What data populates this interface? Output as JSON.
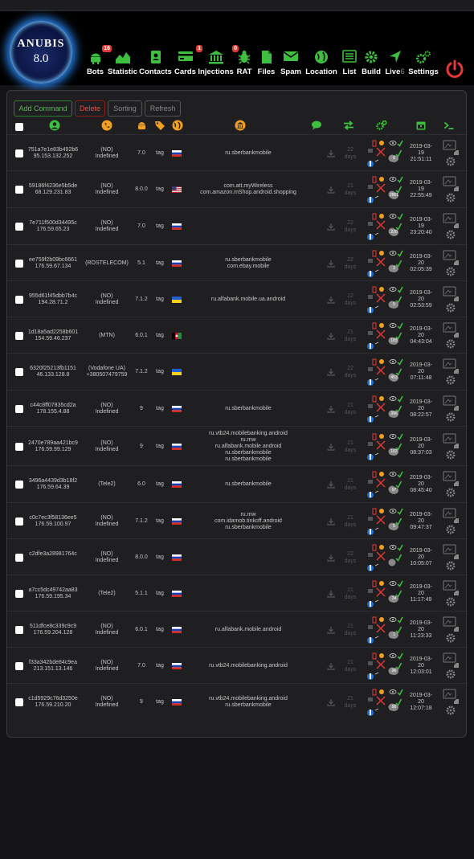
{
  "logo": {
    "title": "ANUBIS",
    "version": "8.0"
  },
  "nav": [
    {
      "label": "Bots",
      "icon": "android-icon",
      "badge": "16"
    },
    {
      "label": "Statistic",
      "icon": "chart-area-icon",
      "badge": ""
    },
    {
      "label": "Contacts",
      "icon": "contacts-book-icon",
      "badge": ""
    },
    {
      "label": "Cards",
      "icon": "credit-card-icon",
      "badge": "1"
    },
    {
      "label": "Injections",
      "icon": "bank-icon",
      "badge": "0"
    },
    {
      "label": "RAT",
      "icon": "bug-icon",
      "badge": ""
    },
    {
      "label": "Files",
      "icon": "files-icon",
      "badge": ""
    },
    {
      "label": "Spam",
      "icon": "envelope-icon",
      "badge": ""
    },
    {
      "label": "Location",
      "icon": "globe-icon",
      "badge": ""
    },
    {
      "label": "List",
      "icon": "list-icon",
      "badge": ""
    },
    {
      "label": "Build",
      "icon": "gear-icon",
      "badge": ""
    },
    {
      "label": "Live",
      "icon": "location-arrow-icon",
      "badge": "",
      "count": "6"
    },
    {
      "label": "Settings",
      "icon": "cogs-icon",
      "badge": ""
    }
  ],
  "toolbar": {
    "add": "Add Command",
    "delete": "Delete",
    "sorting": "Sorting",
    "refresh": "Refresh"
  },
  "columns": [
    "select",
    "user-id",
    "operator",
    "android-version",
    "tag",
    "country",
    "injections",
    "sms",
    "status",
    "permissions",
    "date",
    "console"
  ],
  "colors": {
    "accent_green": "#3fbf3f",
    "danger_red": "#e53935",
    "bg": "#1f1f22"
  },
  "rows": [
    {
      "id": "751a7e1e83b492b6",
      "ip": "95.153.132.252",
      "op1": "(NO)",
      "op2": "Indefined",
      "ver": "7.0",
      "tag": "tag",
      "flag": "ru",
      "apps": [
        "ru.sberbankmobile"
      ],
      "days1": "22",
      "days2": "days",
      "perm": "6",
      "date": [
        "2019-03-",
        "19",
        "21:51:11"
      ]
    },
    {
      "id": "59186f4236e5b5de",
      "ip": "68.129.231.83",
      "op1": "(NO)",
      "op2": "Indefined",
      "ver": "8.0.0",
      "tag": "tag",
      "flag": "us",
      "apps": [
        "com.att.myWireless",
        "com.amazon.mShop.android.shopping"
      ],
      "days1": "21",
      "days2": "days",
      "perm": "2861",
      "date": [
        "2019-03-",
        "19",
        "22:55:49"
      ]
    },
    {
      "id": "7e711f500d34495c",
      "ip": "176.59.65.23",
      "op1": "(NO)",
      "op2": "Indefined",
      "ver": "7.0",
      "tag": "tag",
      "flag": "ru",
      "apps": [],
      "days1": "22",
      "days2": "days",
      "perm": "220",
      "date": [
        "2019-03-",
        "19",
        "23:20:40"
      ]
    },
    {
      "id": "ee759f2b09bc6661",
      "ip": "176.59.67.134",
      "op1": "(ROSTELECOM)",
      "op2": "",
      "ver": "5.1",
      "tag": "tag",
      "flag": "ru",
      "apps": [
        "ru.sberbankmobile",
        "com.ebay.mobile"
      ],
      "days1": "22",
      "days2": "days",
      "perm": "3",
      "date": [
        "2019-03-",
        "20",
        "02:05:39"
      ]
    },
    {
      "id": "955d61f45dbb7b4c",
      "ip": "194.28.71.2",
      "op1": "(NO)",
      "op2": "Indefined",
      "ver": "7.1.2",
      "tag": "tag",
      "flag": "ua",
      "apps": [
        "ru.alfabank.mobile.ua.android"
      ],
      "days1": "22",
      "days2": "days",
      "perm": "5",
      "date": [
        "2019-03-",
        "20",
        "02:53:59"
      ]
    },
    {
      "id": "1d18a5ad2258b601",
      "ip": "154.59.46.237",
      "op1": "(MTN)",
      "op2": "",
      "ver": "6.0.1",
      "tag": "tag",
      "flag": "af",
      "apps": [],
      "days1": "21",
      "days2": "days",
      "perm": "183",
      "date": [
        "2019-03-",
        "20",
        "04:43:04"
      ]
    },
    {
      "id": "6320f25213fb1151",
      "ip": "46.133.128.8",
      "op1": "(Vodafone UA)",
      "op2": "+380507479759",
      "ver": "7.1.2",
      "tag": "tag",
      "flag": "ua",
      "apps": [],
      "days1": "22",
      "days2": "days",
      "perm": "453",
      "date": [
        "2019-03-",
        "20",
        "07:11:48"
      ]
    },
    {
      "id": "c44c8ff07835cd2a",
      "ip": "178.155.4.88",
      "op1": "(NO)",
      "op2": "Indefined",
      "ver": "9",
      "tag": "tag",
      "flag": "ru",
      "apps": [
        "ru.sberbankmobile"
      ],
      "days1": "21",
      "days2": "days",
      "perm": "396",
      "date": [
        "2019-03-",
        "20",
        "08:22:57"
      ]
    },
    {
      "id": "2470e789aa421bc9",
      "ip": "176.59.99.129",
      "op1": "(NO)",
      "op2": "Indefined",
      "ver": "9",
      "tag": "tag",
      "flag": "ru",
      "apps": [
        "ru.vtb24.mobilebanking.android",
        "ru.mw",
        "ru.alfabank.mobile.android",
        "ru.sberbankmobile",
        "ru.sberbankmobile"
      ],
      "days1": "21",
      "days2": "days",
      "perm": "102",
      "date": [
        "2019-03-",
        "20",
        "08:37:03"
      ]
    },
    {
      "id": "3496a4439d3b18f2",
      "ip": "176.59.64.39",
      "op1": "(Tele2)",
      "op2": "",
      "ver": "6.0",
      "tag": "tag",
      "flag": "ru",
      "apps": [
        "ru.sberbankmobile"
      ],
      "days1": "21",
      "days2": "days",
      "perm": "97",
      "date": [
        "2019-03-",
        "20",
        "08:45:40"
      ]
    },
    {
      "id": "c0c7ec3f58136ee5",
      "ip": "176.59.100.97",
      "op1": "(NO)",
      "op2": "Indefined",
      "ver": "7.1.2",
      "tag": "tag",
      "flag": "ru",
      "apps": [
        "ru.mw",
        "com.idamob.tinkoff.android",
        "ru.sberbankmobile"
      ],
      "days1": "21",
      "days2": "days",
      "perm": "5",
      "date": [
        "2019-03-",
        "20",
        "09:47:37"
      ]
    },
    {
      "id": "c2dfe3a28981764c",
      "ip": "",
      "op1": "(NO)",
      "op2": "Indefined",
      "ver": "8.0.0",
      "tag": "tag",
      "flag": "ru",
      "apps": [],
      "days1": "22",
      "days2": "days",
      "perm": "",
      "date": [
        "2019-03-",
        "20",
        "10:05:07"
      ]
    },
    {
      "id": "a7cc5dc49742aa83",
      "ip": "176.59.195.34",
      "op1": "(Tele2)",
      "op2": "",
      "ver": "5.1.1",
      "tag": "tag",
      "flag": "ru",
      "apps": [],
      "days1": "21",
      "days2": "days",
      "perm": "34",
      "date": [
        "2019-03-",
        "20",
        "11:17:49"
      ]
    },
    {
      "id": "511dfce8c339c9c9",
      "ip": "176.59.204.128",
      "op1": "(NO)",
      "op2": "Indefined",
      "ver": "6.0.1",
      "tag": "tag",
      "flag": "ru",
      "apps": [
        "ru.alfabank.mobile.android"
      ],
      "days1": "21",
      "days2": "days",
      "perm": "1",
      "date": [
        "2019-03-",
        "20",
        "11:23:33"
      ]
    },
    {
      "id": "f33a342bde84c9ea",
      "ip": "213.151.13.146",
      "op1": "(NO)",
      "op2": "Indefined",
      "ver": "7.0",
      "tag": "tag",
      "flag": "ru",
      "apps": [
        "ru.vtb24.mobilebanking.android"
      ],
      "days1": "21",
      "days2": "days",
      "perm": "96",
      "date": [
        "2019-03-",
        "20",
        "12:03:01"
      ]
    },
    {
      "id": "c1d5929c76d3250e",
      "ip": "176.59.210.20",
      "op1": "(NO)",
      "op2": "Indefined",
      "ver": "9",
      "tag": "tag",
      "flag": "ru",
      "apps": [
        "ru.vtb24.mobilebanking.android",
        "ru.sberbankmobile"
      ],
      "days1": "21",
      "days2": "days",
      "perm": "90",
      "date": [
        "2019-03-",
        "20",
        "12:07:18"
      ]
    }
  ]
}
